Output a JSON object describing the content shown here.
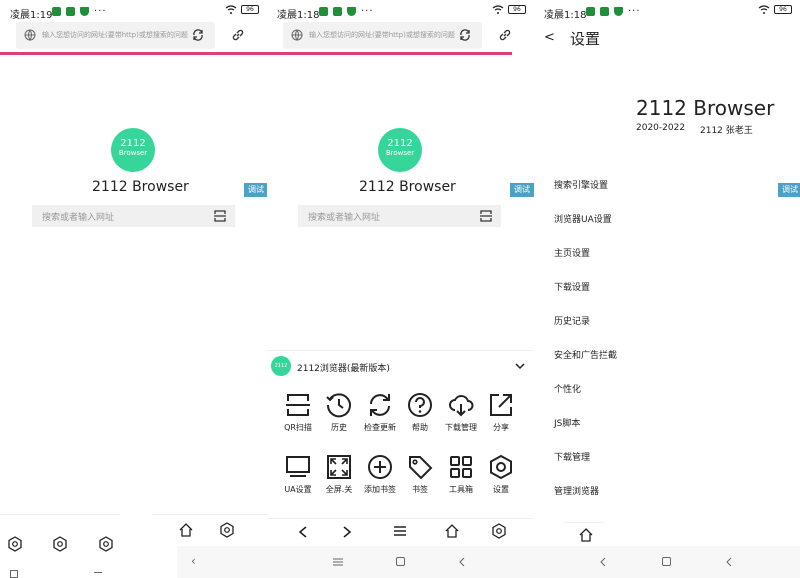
{
  "panels": [
    {
      "status": {
        "time": "凌晨1:19",
        "battery": "96"
      },
      "url_placeholder": "输入您想访问的网址(要带http)或想搜索的问题",
      "logo": {
        "line1": "2112",
        "line2": "Browser"
      },
      "brand": "2112 Browser",
      "search_placeholder": "搜索或者输入网址",
      "debug_label": "调试"
    },
    {
      "status": {
        "time": "凌晨1:18",
        "battery": "96"
      },
      "url_placeholder": "输入您想访问的网址(要带http)或想搜索的问题",
      "logo": {
        "line1": "2112",
        "line2": "Browser"
      },
      "brand": "2112 Browser",
      "search_placeholder": "搜索或者输入网址",
      "debug_label": "调试",
      "menu": {
        "title": "2112浏览器(最新版本)",
        "row1": [
          {
            "label": "QR扫描",
            "icon": "scan-icon"
          },
          {
            "label": "历史",
            "icon": "history-icon"
          },
          {
            "label": "检查更新",
            "icon": "refresh-icon"
          },
          {
            "label": "帮助",
            "icon": "help-icon"
          },
          {
            "label": "下载管理",
            "icon": "cloud-download-icon"
          },
          {
            "label": "分享",
            "icon": "share-icon"
          }
        ],
        "row2": [
          {
            "label": "UA设置",
            "icon": "monitor-icon"
          },
          {
            "label": "全屏.关",
            "icon": "fullscreen-icon"
          },
          {
            "label": "添加书签",
            "icon": "add-circle-icon"
          },
          {
            "label": "书签",
            "icon": "tag-icon"
          },
          {
            "label": "工具箱",
            "icon": "grid-icon"
          },
          {
            "label": "设置",
            "icon": "hexagon-settings-icon"
          }
        ]
      }
    },
    {
      "status": {
        "time": "凌晨1:18",
        "battery": "96"
      },
      "back": "<",
      "title": "设置",
      "app_name": "2112 Browser",
      "years": "2020-2022",
      "author": "2112 张老王",
      "debug_label": "调试",
      "items": [
        "搜索引擎设置",
        "浏览器UA设置",
        "主页设置",
        "下载设置",
        "历史记录",
        "安全和广告拦截",
        "个性化",
        "JS脚本",
        "下载管理",
        "管理浏览器"
      ]
    }
  ],
  "colors": {
    "accent": "#36d59a",
    "progress": "#e23c7a",
    "debug": "#4aa3c7"
  }
}
